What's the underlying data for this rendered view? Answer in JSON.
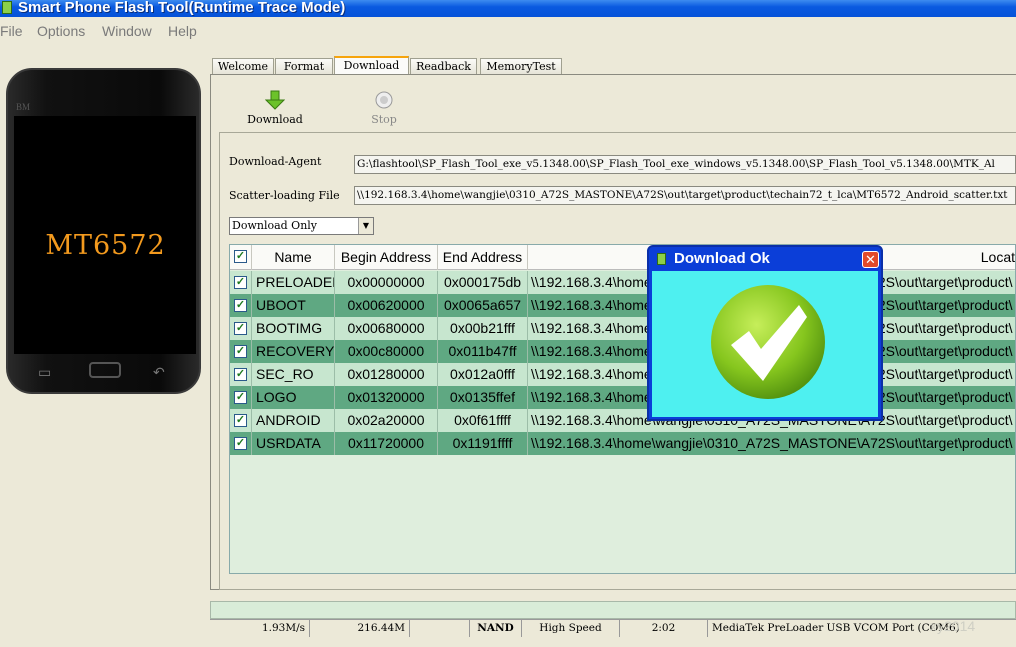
{
  "window": {
    "title": "Smart Phone Flash Tool(Runtime Trace Mode)"
  },
  "menu": [
    {
      "label": "File"
    },
    {
      "label": "Options"
    },
    {
      "label": "Window"
    },
    {
      "label": "Help"
    }
  ],
  "phone": {
    "brand": "BM",
    "model": "MT6572"
  },
  "tabs": [
    {
      "label": "Welcome"
    },
    {
      "label": "Format"
    },
    {
      "label": "Download"
    },
    {
      "label": "Readback"
    },
    {
      "label": "MemoryTest"
    }
  ],
  "toolbar": {
    "download_label": "Download",
    "stop_label": "Stop"
  },
  "download_agent": {
    "label": "Download-Agent",
    "value": "G:\\flashtool\\SP_Flash_Tool_exe_v5.1348.00\\SP_Flash_Tool_exe_windows_v5.1348.00\\SP_Flash_Tool_v5.1348.00\\MTK_Al"
  },
  "scatter": {
    "label": "Scatter-loading File",
    "value": "\\\\192.168.3.4\\home\\wangjie\\0310_A72S_MASTONE\\A72S\\out\\target\\product\\techain72_t_lca\\MT6572_Android_scatter.txt"
  },
  "mode_select": {
    "value": "Download Only"
  },
  "table": {
    "columns": [
      "Name",
      "Begin Address",
      "End Address",
      "Locat"
    ],
    "rows": [
      {
        "checked": "✓",
        "name": "PRELOADER",
        "begin": "0x00000000",
        "end": "0x000175db",
        "location": "\\\\192.168.3.4\\home\\wangjie\\0310_A72S_MASTONE\\A72S\\out\\target\\product\\"
      },
      {
        "checked": "✓",
        "name": "UBOOT",
        "begin": "0x00620000",
        "end": "0x0065a657",
        "location": "\\\\192.168.3.4\\home\\wangjie\\0310_A72S_MASTONE\\A72S\\out\\target\\product\\"
      },
      {
        "checked": "✓",
        "name": "BOOTIMG",
        "begin": "0x00680000",
        "end": "0x00b21fff",
        "location": "\\\\192.168.3.4\\home\\wangjie\\0310_A72S_MASTONE\\A72S\\out\\target\\product\\"
      },
      {
        "checked": "✓",
        "name": "RECOVERY",
        "begin": "0x00c80000",
        "end": "0x011b47ff",
        "location": "\\\\192.168.3.4\\home\\wangjie\\0310_A72S_MASTONE\\A72S\\out\\target\\product\\"
      },
      {
        "checked": "✓",
        "name": "SEC_RO",
        "begin": "0x01280000",
        "end": "0x012a0fff",
        "location": "\\\\192.168.3.4\\home\\wangjie\\0310_A72S_MASTONE\\A72S\\out\\target\\product\\"
      },
      {
        "checked": "✓",
        "name": "LOGO",
        "begin": "0x01320000",
        "end": "0x0135ffef",
        "location": "\\\\192.168.3.4\\home\\wangjie\\0310_A72S_MASTONE\\A72S\\out\\target\\product\\"
      },
      {
        "checked": "✓",
        "name": "ANDROID",
        "begin": "0x02a20000",
        "end": "0x0f61ffff",
        "location": "\\\\192.168.3.4\\home\\wangjie\\0310_A72S_MASTONE\\A72S\\out\\target\\product\\"
      },
      {
        "checked": "✓",
        "name": "USRDATA",
        "begin": "0x11720000",
        "end": "0x1191ffff",
        "location": "\\\\192.168.3.4\\home\\wangjie\\0310_A72S_MASTONE\\A72S\\out\\target\\product\\"
      }
    ]
  },
  "status": {
    "speed": "1.93M/s",
    "size": "216.44M",
    "storage": "NAND",
    "usb_speed": "High Speed",
    "time": "2:02",
    "port": "MediaTek PreLoader USB VCOM Port (COM6)"
  },
  "dialog": {
    "title": "Download Ok",
    "close_icon": "close-icon",
    "check_icon": "check-icon"
  },
  "colors": {
    "row_odd": "#c7e6cf",
    "row_even": "#5fa882",
    "dialog_body": "#4ef0f0",
    "dialog_title": "#0b3ed8",
    "check_green": "#7cc21e"
  }
}
